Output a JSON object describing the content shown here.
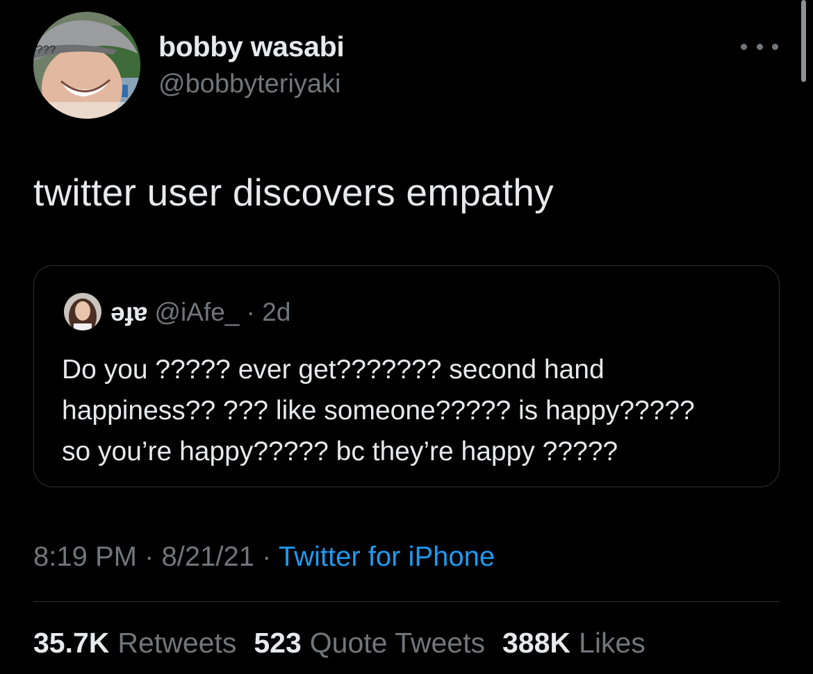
{
  "author": {
    "name": "bobby wasabi",
    "handle": "@bobbyteriyaki",
    "avatar_overlay_text": "???"
  },
  "tweet": {
    "text": "twitter user discovers empathy"
  },
  "quoted_tweet": {
    "name": "ǝɟɐ",
    "handle": "@iAfe_",
    "separator": "·",
    "age": "2d",
    "lines": [
      "Do you ????? ever get??????? second hand",
      "happiness?? ??? like someone????? is happy?????",
      "so you’re happy????? bc they’re happy ?????"
    ]
  },
  "meta": {
    "time": "8:19 PM",
    "sep1": "·",
    "date": "8/21/21",
    "sep2": "·",
    "source": "Twitter for iPhone"
  },
  "stats": [
    {
      "value": "35.7K",
      "label": "Retweets"
    },
    {
      "value": "523",
      "label": "Quote Tweets"
    },
    {
      "value": "388K",
      "label": "Likes"
    }
  ],
  "colors": {
    "background": "#000000",
    "text": "#e7e9ea",
    "secondary": "#71767b",
    "link": "#1d9bf0",
    "border": "#2f3336"
  },
  "icons": {
    "more": "more-options-icon"
  }
}
